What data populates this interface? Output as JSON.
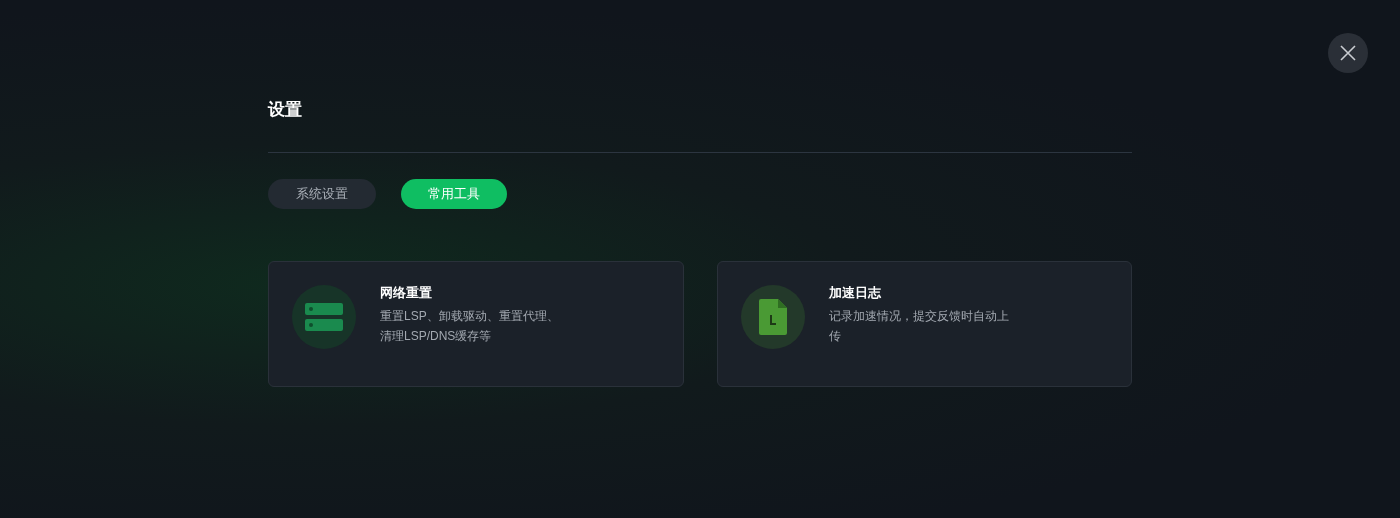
{
  "dialog": {
    "title": "设置"
  },
  "tabs": [
    {
      "label": "系统设置",
      "selected": false
    },
    {
      "label": "常用工具",
      "selected": true
    }
  ],
  "tools": [
    {
      "kind": "server",
      "title": "网络重置",
      "description_lines": [
        "重置LSP、卸载驱动、重置代理、",
        "清理LSP/DNS缓存等"
      ]
    },
    {
      "kind": "log",
      "title": "加速日志",
      "description_lines": [
        "记录加速情况，提交反馈时自动上",
        "传"
      ]
    }
  ]
}
